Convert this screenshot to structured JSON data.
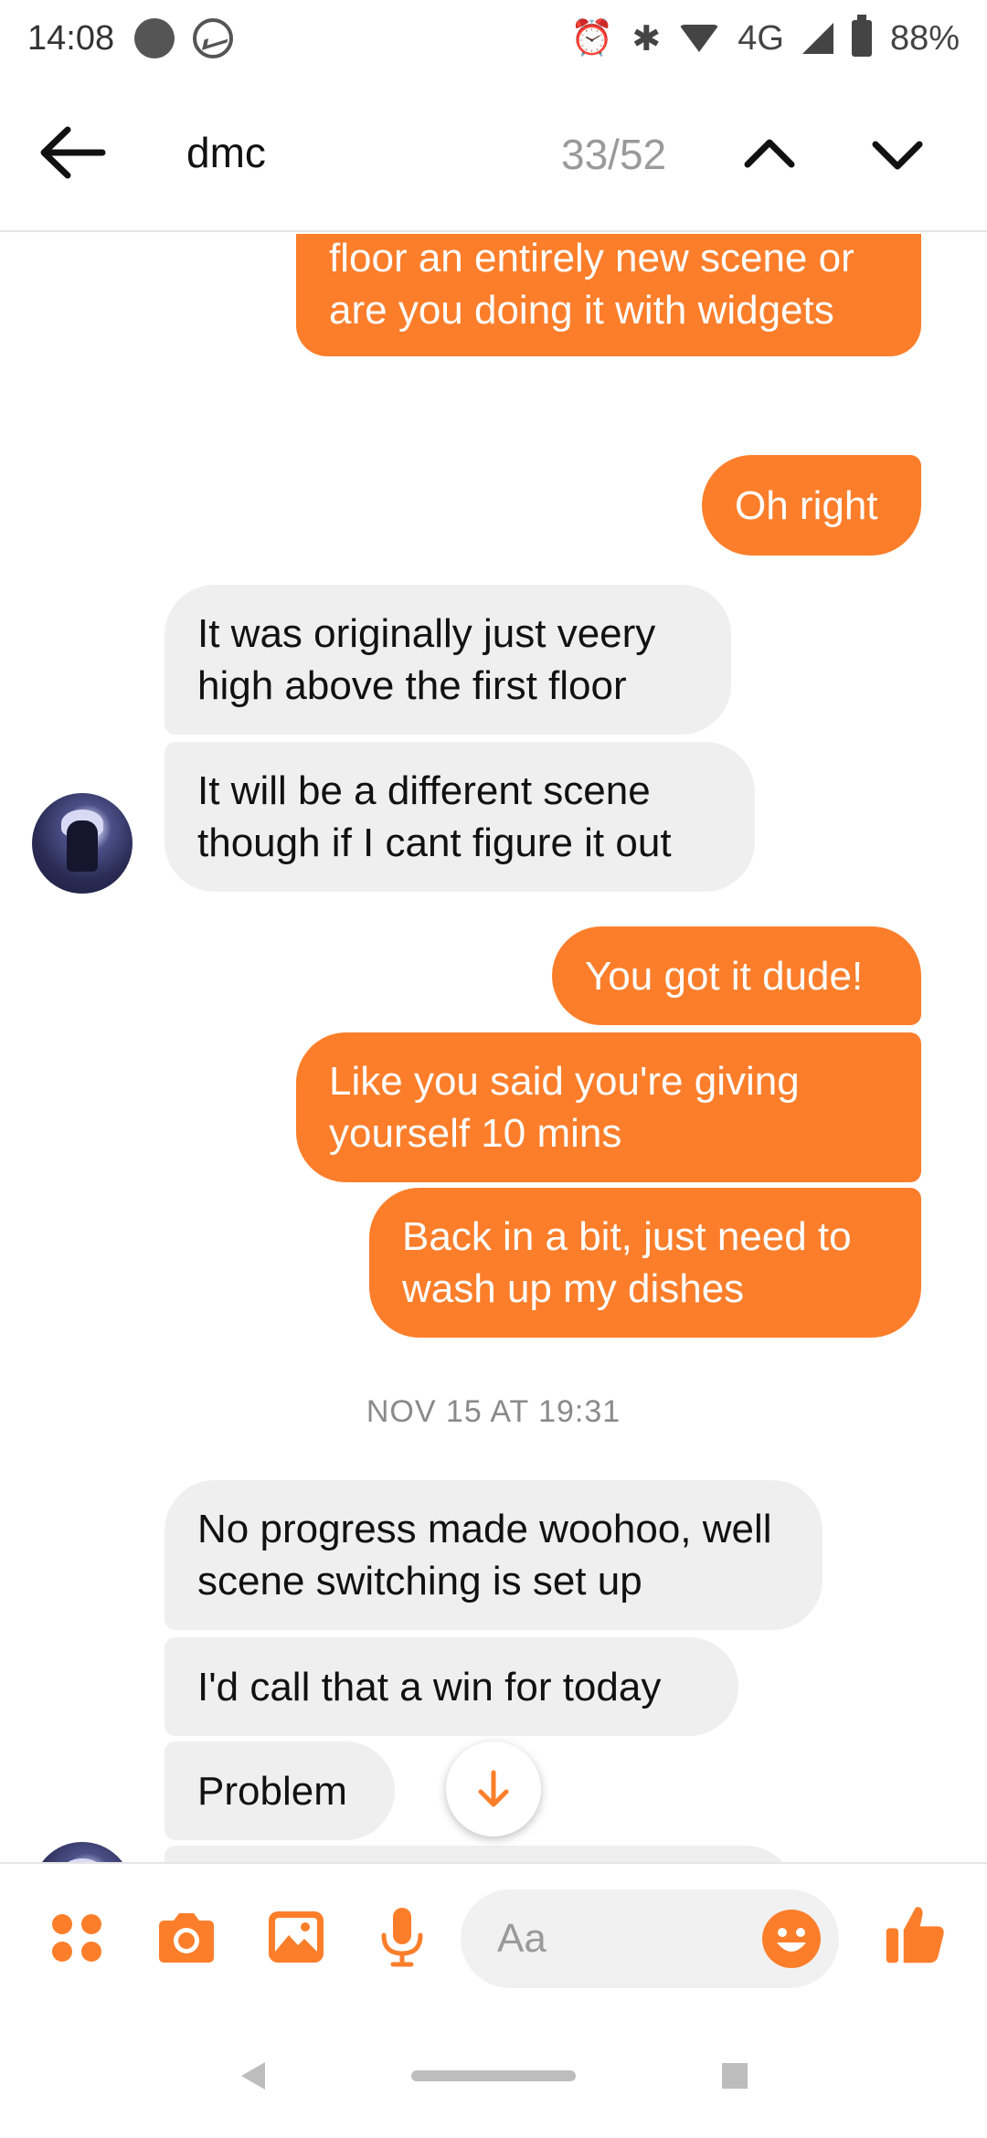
{
  "status_bar": {
    "time": "14:08",
    "network": "4G",
    "battery": "88%"
  },
  "header": {
    "search_term": "dmc",
    "match_count": "33/52"
  },
  "messages": [
    {
      "direction": "out",
      "text": "Have you made the second floor an entirely new scene or are you doing it with widgets"
    },
    {
      "direction": "out",
      "text": "Oh right"
    },
    {
      "direction": "in",
      "text": "It was originally just veery high above the first floor"
    },
    {
      "direction": "in",
      "text": "It will be a different scene though if I cant figure it out"
    },
    {
      "direction": "out",
      "text": "You got it dude!"
    },
    {
      "direction": "out",
      "text": "Like you said you're giving yourself 10 mins"
    },
    {
      "direction": "out",
      "text": "Back in a bit, just need to wash up my dishes"
    },
    {
      "direction": "in",
      "text": "No progress made woohoo, well scene switching is set up"
    },
    {
      "direction": "in",
      "text": "I'd call that a win for today"
    },
    {
      "direction": "in",
      "text": "Problem"
    }
  ],
  "timestamp": "NOV 15 AT 19:31",
  "composer": {
    "placeholder": "Aa"
  },
  "icons": {
    "back": "arrow-left-icon",
    "prev_match": "chevron-up-icon",
    "next_match": "chevron-down-icon",
    "apps": "four-dots-icon",
    "camera": "camera-icon",
    "gallery": "image-icon",
    "voice": "microphone-icon",
    "emoji": "smiley-icon",
    "like": "thumbs-up-icon",
    "scroll_down": "arrow-down-icon"
  },
  "colors": {
    "accent": "#fc7e2b",
    "incoming_bubble": "#efefef",
    "outgoing_text": "#ffffff"
  }
}
